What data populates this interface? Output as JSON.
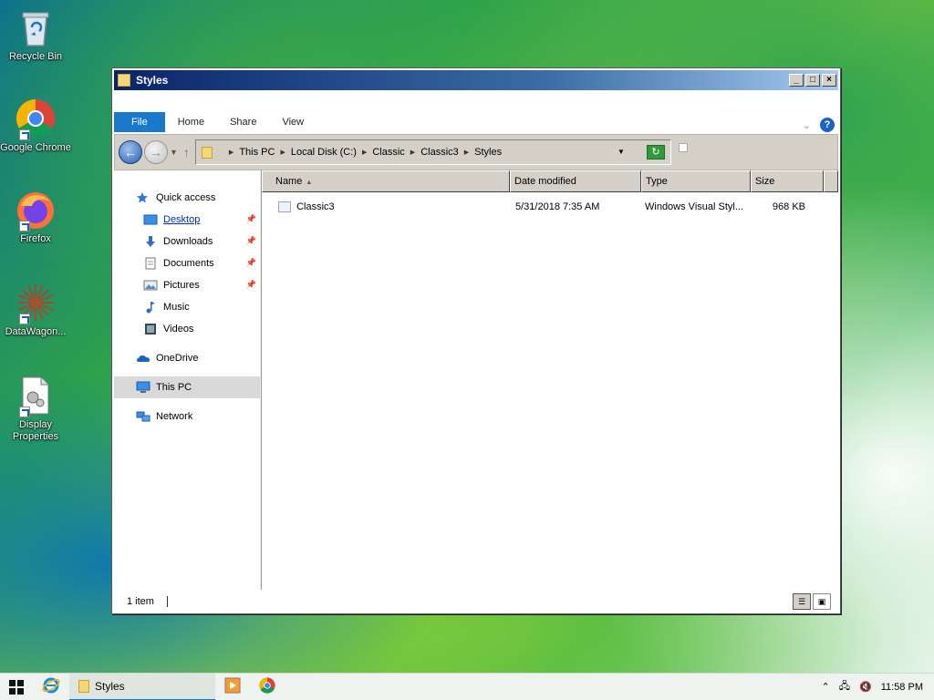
{
  "desktop": {
    "icons": [
      {
        "label": "Recycle Bin",
        "icon": "recycle-bin-icon"
      },
      {
        "label": "Google Chrome",
        "icon": "chrome-icon"
      },
      {
        "label": "Firefox",
        "icon": "firefox-icon"
      },
      {
        "label": "DataWagon...",
        "icon": "datawagon-icon"
      },
      {
        "label": "Display Properties",
        "icon": "display-properties-icon"
      }
    ]
  },
  "window": {
    "title": "Styles",
    "controls": {
      "minimize": "_",
      "maximize": "□",
      "close": "×"
    },
    "ribbon": {
      "tabs": [
        "File",
        "Home",
        "Share",
        "View"
      ],
      "help": "?"
    },
    "address": {
      "breadcrumbs": [
        "This PC",
        "Local Disk (C:)",
        "Classic",
        "Classic3",
        "Styles"
      ]
    },
    "nav": {
      "quick_access": "Quick access",
      "pinned": [
        {
          "label": "Desktop",
          "icon": "desktop-icon",
          "pinned": true
        },
        {
          "label": "Downloads",
          "icon": "downloads-icon",
          "pinned": true
        },
        {
          "label": "Documents",
          "icon": "documents-icon",
          "pinned": true
        },
        {
          "label": "Pictures",
          "icon": "pictures-icon",
          "pinned": true
        },
        {
          "label": "Music",
          "icon": "music-icon",
          "pinned": false
        },
        {
          "label": "Videos",
          "icon": "videos-icon",
          "pinned": false
        }
      ],
      "onedrive": "OneDrive",
      "this_pc": "This PC",
      "network": "Network"
    },
    "columns": [
      "Name",
      "Date modified",
      "Type",
      "Size"
    ],
    "files": [
      {
        "name": "Classic3",
        "date": "5/31/2018 7:35 AM",
        "type": "Windows Visual Styl...",
        "size": "968 KB"
      }
    ],
    "status": {
      "count": "1 item"
    }
  },
  "taskbar": {
    "active_window": "Styles",
    "clock": "11:58 PM"
  },
  "colors": {
    "accent": "#1979ca",
    "titlebar": "#0a246a"
  }
}
